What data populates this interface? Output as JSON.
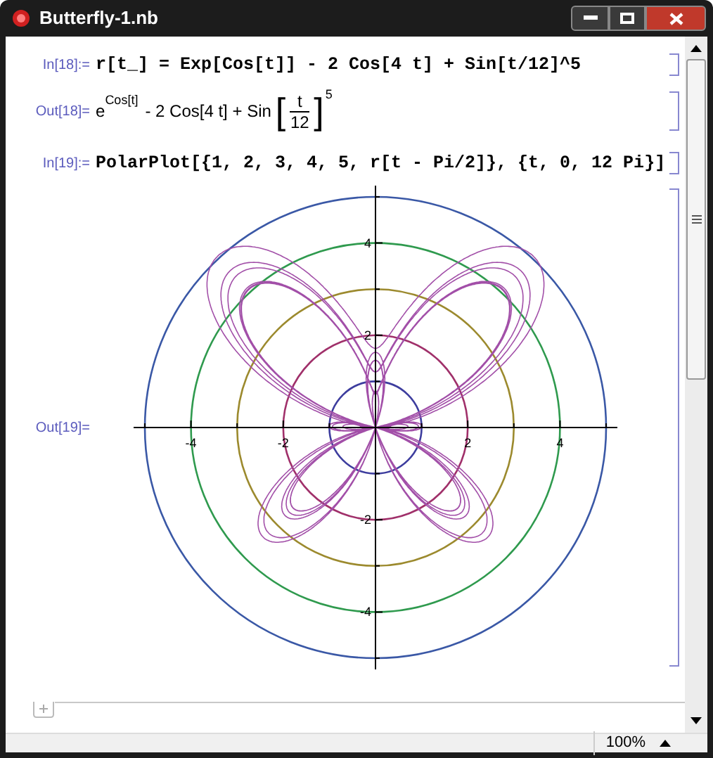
{
  "window": {
    "title": "Butterfly-1.nb"
  },
  "cells": [
    {
      "kind": "input",
      "label": "In[18]:=",
      "code": "r[t_] = Exp[Cos[t]] - 2 Cos[4 t] + Sin[t/12]^5"
    },
    {
      "kind": "output",
      "label": "Out[18]=",
      "base": "e",
      "exponent": "Cos[t]",
      "middle": "- 2 Cos[4 t] + Sin",
      "open_bracket": "[",
      "numerator": "t",
      "denominator": "12",
      "close_bracket": "]",
      "power": "5"
    },
    {
      "kind": "input",
      "label": "In[19]:=",
      "code": "PolarPlot[{1, 2, 3, 4, 5, r[t - Pi/2]}, {t, 0, 12 Pi}]"
    },
    {
      "kind": "plot",
      "label": "Out[19]=",
      "x_ticks": [
        "-4",
        "-2",
        "2",
        "4"
      ],
      "y_ticks": [
        "4",
        "2",
        "-2",
        "-4"
      ]
    }
  ],
  "status_bar": {
    "zoom": "100%"
  }
}
